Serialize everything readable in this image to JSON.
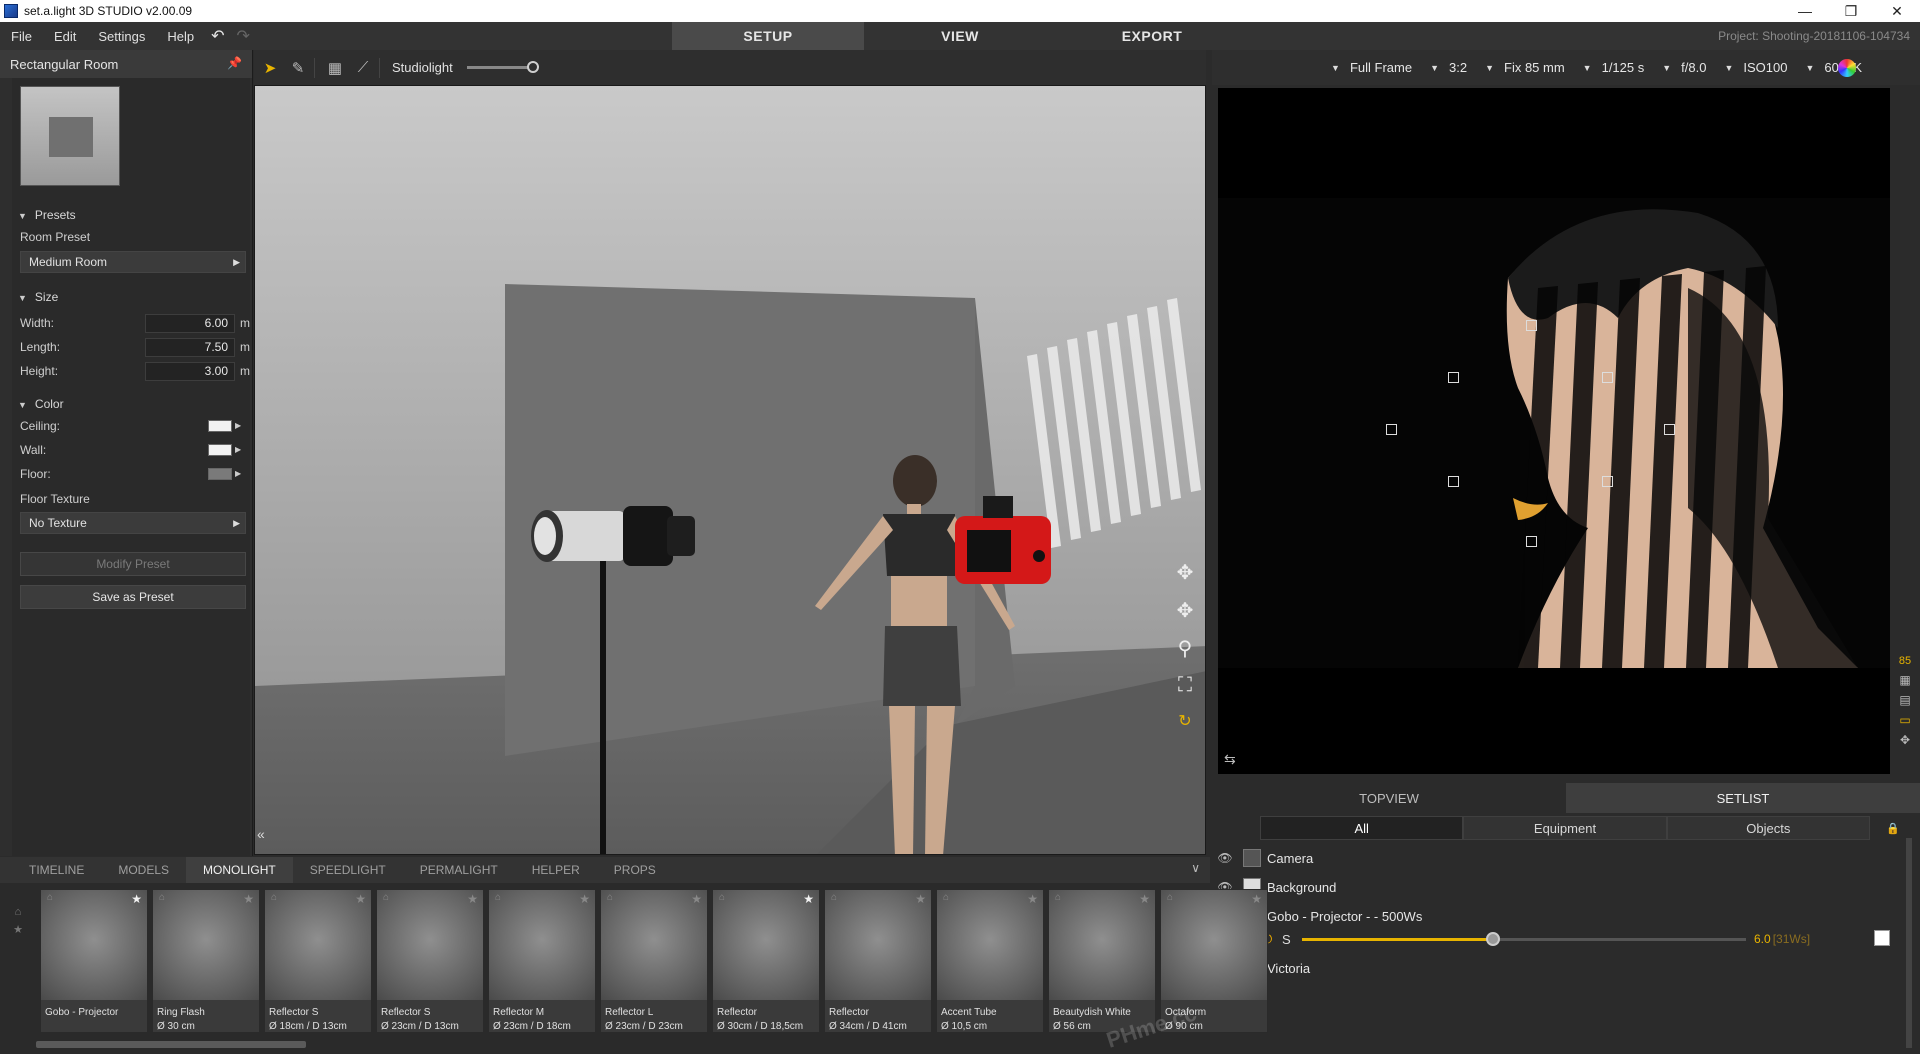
{
  "window": {
    "title": "set.a.light 3D STUDIO v2.00.09"
  },
  "menu": {
    "items": [
      "File",
      "Edit",
      "Settings",
      "Help"
    ]
  },
  "modes": [
    {
      "label": "SETUP",
      "active": true
    },
    {
      "label": "VIEW",
      "active": false
    },
    {
      "label": "EXPORT",
      "active": false
    }
  ],
  "project": {
    "name": "Project: Shooting-20181106-104734"
  },
  "left_panel": {
    "title": "Rectangular Room",
    "presets": {
      "section": "Presets",
      "label": "Room Preset",
      "value": "Medium Room"
    },
    "size": {
      "section": "Size",
      "width": {
        "label": "Width:",
        "value": "6.00",
        "unit": "m"
      },
      "length": {
        "label": "Length:",
        "value": "7.50",
        "unit": "m"
      },
      "height": {
        "label": "Height:",
        "value": "3.00",
        "unit": "m"
      }
    },
    "color": {
      "section": "Color",
      "ceiling": {
        "label": "Ceiling:",
        "color": "#f2f2f2"
      },
      "wall": {
        "label": "Wall:",
        "color": "#f2f2f2"
      },
      "floor": {
        "label": "Floor:",
        "color": "#7a7a7a"
      },
      "floor_texture_label": "Floor Texture",
      "floor_texture_value": "No Texture"
    },
    "modify_preset": "Modify Preset",
    "save_preset": "Save as Preset"
  },
  "viewport_toolbar": {
    "studiolight_label": "Studiolight",
    "studiolight_level": 1.0
  },
  "camera": {
    "format": "Full Frame",
    "ratio": "3:2",
    "lens": "Fix 85 mm",
    "shutter": "1/125 s",
    "aperture": "f/8.0",
    "iso": "ISO100",
    "wb": "6000K"
  },
  "side_tools": {
    "zoom_value": "85"
  },
  "panel_tabs": [
    {
      "label": "TOPVIEW",
      "active": false
    },
    {
      "label": "SETLIST",
      "active": true
    }
  ],
  "setlist_filters": [
    {
      "label": "All",
      "active": true
    },
    {
      "label": "Equipment",
      "active": false
    },
    {
      "label": "Objects",
      "active": false
    }
  ],
  "setlist": [
    {
      "name": "Camera"
    },
    {
      "name": "Background"
    },
    {
      "name": "Gobo - Projector -  - 500Ws"
    },
    {
      "name": "Victoria"
    }
  ],
  "gobo_control": {
    "size_label": "S",
    "value": "6.0",
    "ws": "[31Ws]",
    "level": 0.43
  },
  "bottom_tabs": [
    {
      "label": "TIMELINE",
      "active": false
    },
    {
      "label": "MODELS",
      "active": false
    },
    {
      "label": "MONOLIGHT",
      "active": true
    },
    {
      "label": "SPEEDLIGHT",
      "active": false
    },
    {
      "label": "PERMALIGHT",
      "active": false
    },
    {
      "label": "HELPER",
      "active": false
    },
    {
      "label": "PROPS",
      "active": false
    }
  ],
  "tray": [
    {
      "name": "Gobo - Projector",
      "detail": "",
      "star": true
    },
    {
      "name": "Ring Flash",
      "detail": "Ø 30 cm",
      "star": false
    },
    {
      "name": "Reflector S",
      "detail": "Ø 18cm / D 13cm",
      "star": false
    },
    {
      "name": "Reflector S",
      "detail": "Ø 23cm / D 13cm",
      "star": false
    },
    {
      "name": "Reflector M",
      "detail": "Ø 23cm / D 18cm",
      "star": false
    },
    {
      "name": "Reflector L",
      "detail": "Ø 23cm / D 23cm",
      "star": false
    },
    {
      "name": "Reflector",
      "detail": "Ø 30cm / D 18,5cm",
      "star": true
    },
    {
      "name": "Reflector",
      "detail": "Ø 34cm / D 41cm",
      "star": false
    },
    {
      "name": "Accent Tube",
      "detail": "Ø 10,5 cm",
      "star": false
    },
    {
      "name": "Beautydish White",
      "detail": "Ø 56 cm",
      "star": false
    },
    {
      "name": "Octaform",
      "detail": "Ø 90 cm",
      "star": false
    }
  ],
  "watermark": "PHme.cc"
}
